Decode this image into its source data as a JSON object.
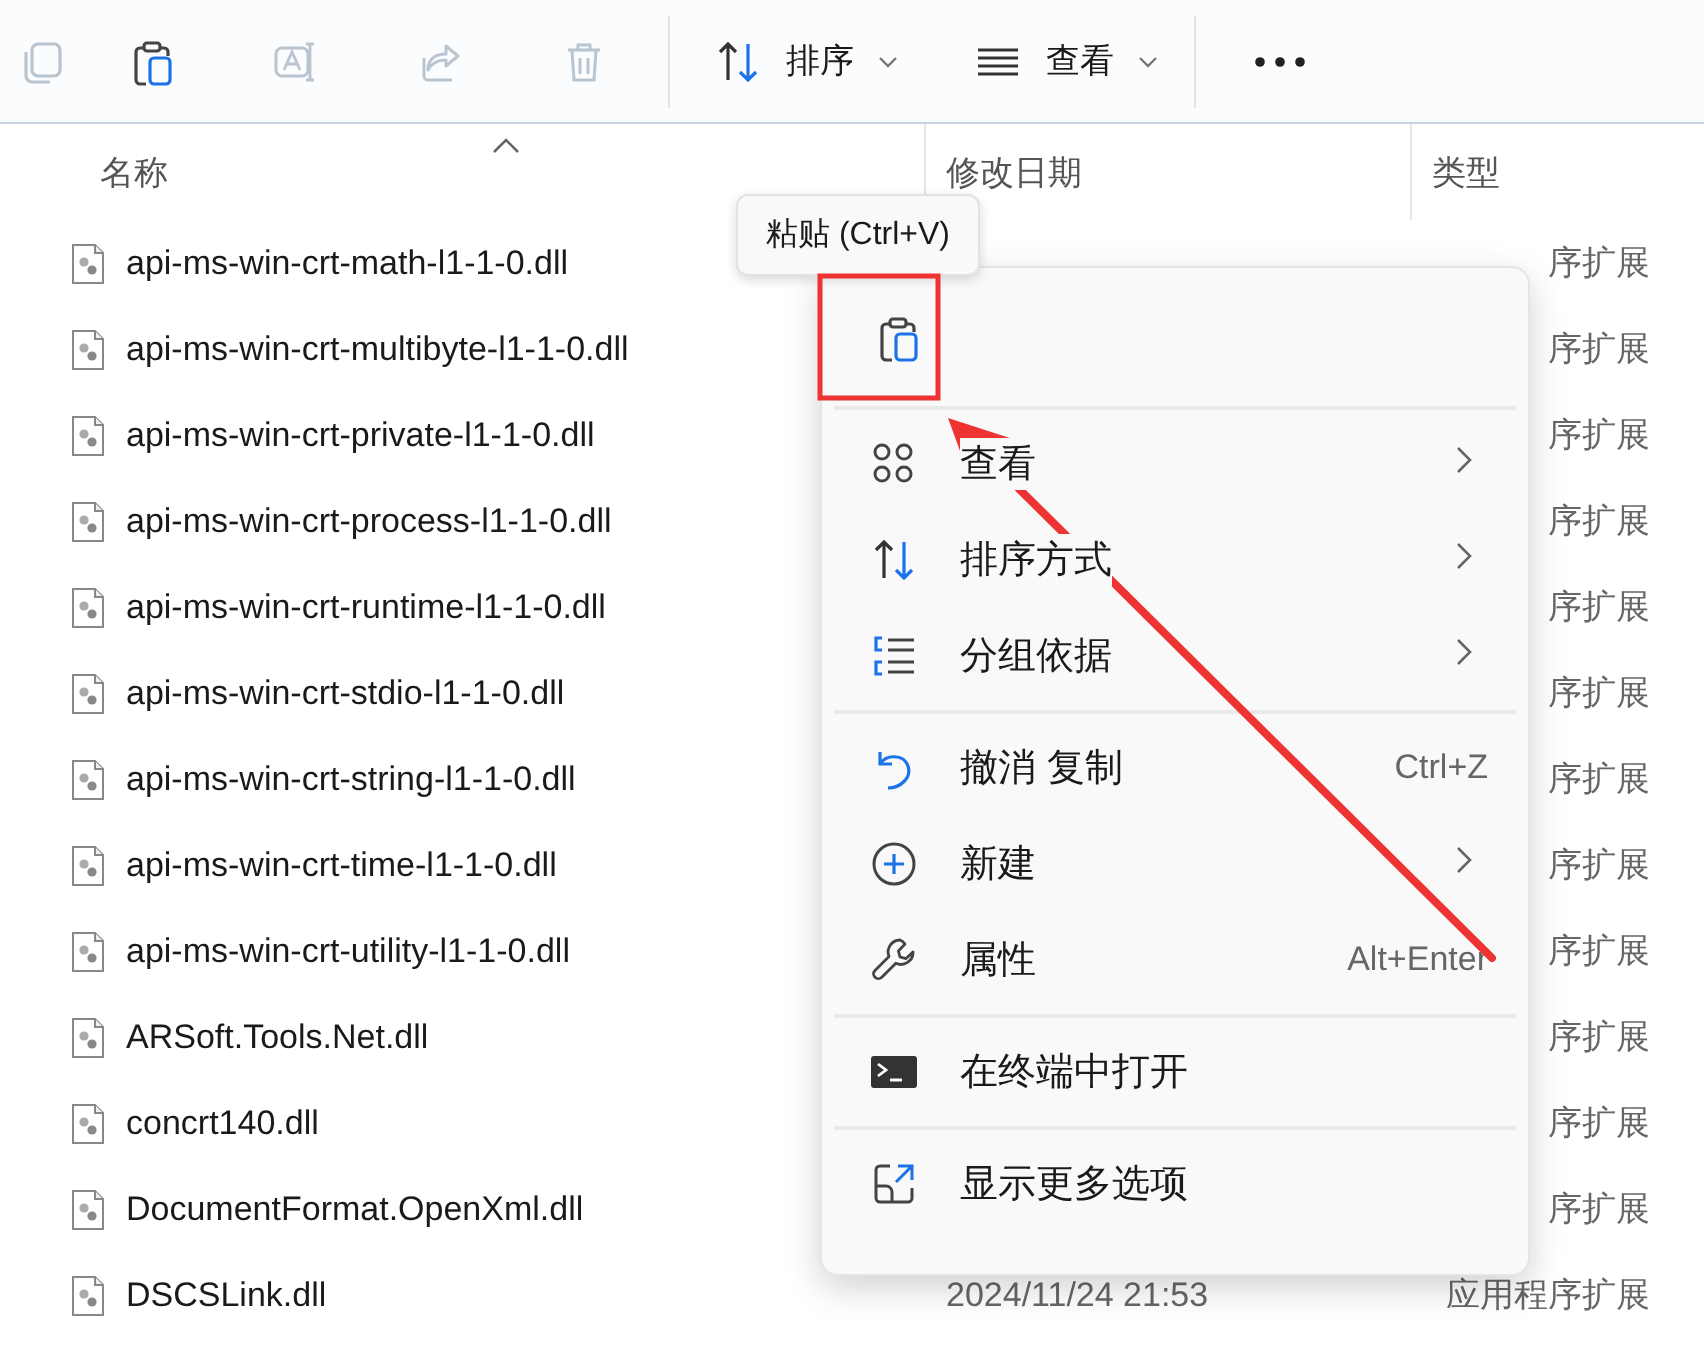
{
  "toolbar": {
    "actions": [
      {
        "kind": "copy",
        "disabled": true
      },
      {
        "kind": "paste",
        "disabled": false
      },
      {
        "kind": "rename",
        "disabled": true
      },
      {
        "kind": "share",
        "disabled": true
      },
      {
        "kind": "delete",
        "disabled": true
      }
    ],
    "menus": [
      {
        "kind": "sort",
        "label": "排序"
      },
      {
        "kind": "view",
        "label": "查看"
      }
    ]
  },
  "table": {
    "columns": [
      {
        "label": "名称",
        "sorted": true
      },
      {
        "label": "修改日期",
        "sorted": false
      },
      {
        "label": "类型",
        "sorted": false
      }
    ],
    "rows": [
      {
        "name": "api-ms-win-crt-math-l1-1-0.dll",
        "type": "序扩展"
      },
      {
        "name": "api-ms-win-crt-multibyte-l1-1-0.dll",
        "type": "序扩展"
      },
      {
        "name": "api-ms-win-crt-private-l1-1-0.dll",
        "type": "序扩展"
      },
      {
        "name": "api-ms-win-crt-process-l1-1-0.dll",
        "type": "序扩展"
      },
      {
        "name": "api-ms-win-crt-runtime-l1-1-0.dll",
        "type": "序扩展"
      },
      {
        "name": "api-ms-win-crt-stdio-l1-1-0.dll",
        "type": "序扩展"
      },
      {
        "name": "api-ms-win-crt-string-l1-1-0.dll",
        "type": "序扩展"
      },
      {
        "name": "api-ms-win-crt-time-l1-1-0.dll",
        "type": "序扩展"
      },
      {
        "name": "api-ms-win-crt-utility-l1-1-0.dll",
        "type": "序扩展"
      },
      {
        "name": "ARSoft.Tools.Net.dll",
        "type": "序扩展"
      },
      {
        "name": "concrt140.dll",
        "type": "序扩展"
      },
      {
        "name": "DocumentFormat.OpenXml.dll",
        "type": "序扩展"
      },
      {
        "name": "DSCSLink.dll",
        "modified": "2024/11/24 21:53",
        "type": "应用程序扩展"
      }
    ]
  },
  "tooltip": {
    "text": "粘贴 (Ctrl+V)"
  },
  "context_menu": {
    "top_actions": [
      {
        "kind": "paste",
        "highlighted": true
      }
    ],
    "groups": [
      [
        {
          "kind": "view",
          "label": "查看",
          "submenu": true
        },
        {
          "kind": "sort",
          "label": "排序方式",
          "submenu": true
        },
        {
          "kind": "group",
          "label": "分组依据",
          "submenu": true
        }
      ],
      [
        {
          "kind": "undo",
          "label": "撤消 复制",
          "shortcut": "Ctrl+Z",
          "submenu": false
        },
        {
          "kind": "new",
          "label": "新建",
          "submenu": true
        },
        {
          "kind": "properties",
          "label": "属性",
          "shortcut": "Alt+Enter",
          "submenu": false
        }
      ],
      [
        {
          "kind": "terminal",
          "label": "在终端中打开",
          "submenu": false
        }
      ],
      [
        {
          "kind": "more",
          "label": "显示更多选项",
          "submenu": false
        }
      ]
    ]
  }
}
